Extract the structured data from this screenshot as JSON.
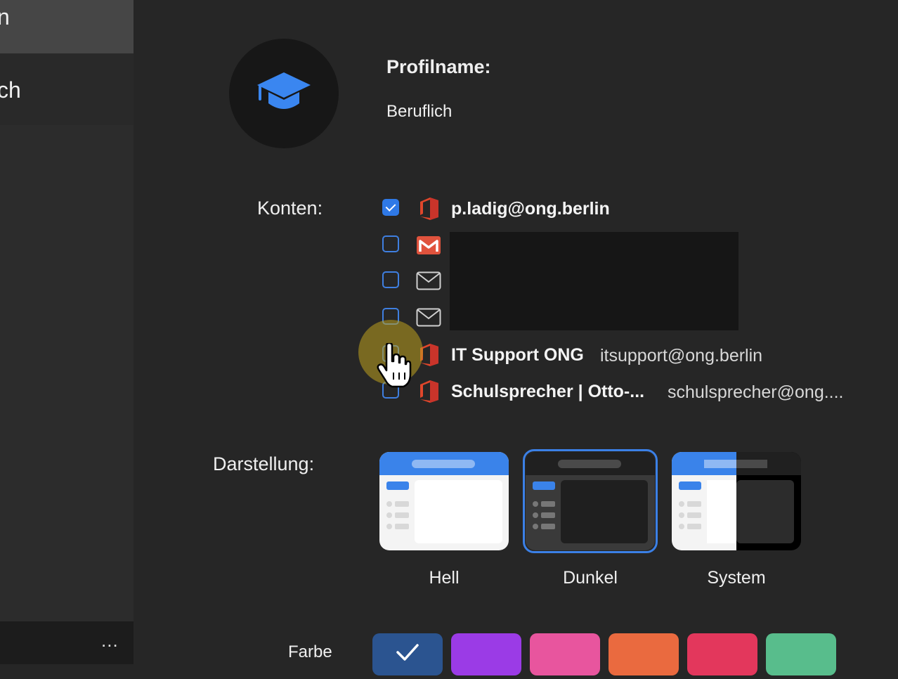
{
  "sidebar": {
    "items": [
      {
        "label": "n"
      },
      {
        "label": "ch"
      }
    ],
    "more_label": "..."
  },
  "profile": {
    "name_label": "Profilname:",
    "name_value": "Beruflich",
    "avatar_icon": "graduation-cap-icon"
  },
  "accounts": {
    "label": "Konten:",
    "items": [
      {
        "name": "p.ladig@ong.berlin",
        "email": "",
        "icon": "office-icon",
        "checked": true
      },
      {
        "name": "",
        "email": "",
        "icon": "gmail-icon",
        "checked": false
      },
      {
        "name": "",
        "email": "",
        "icon": "mail-icon",
        "checked": false
      },
      {
        "name": "",
        "email": "",
        "icon": "mail-icon",
        "checked": false
      },
      {
        "name": "IT Support ONG",
        "email": "itsupport@ong.berlin",
        "icon": "office-icon",
        "checked": false
      },
      {
        "name": "Schulsprecher | Otto-...",
        "email": "schulsprecher@ong....",
        "icon": "office-icon",
        "checked": false
      }
    ]
  },
  "appearance": {
    "label": "Darstellung:",
    "options": [
      {
        "label": "Hell",
        "selected": false
      },
      {
        "label": "Dunkel",
        "selected": true
      },
      {
        "label": "System",
        "selected": false
      }
    ]
  },
  "color": {
    "label": "Farbe",
    "swatches": [
      "#2b5490",
      "#9b3be6",
      "#e8559e",
      "#ea6a3f",
      "#e3375c",
      "#58bd8c"
    ],
    "selected_index": 0
  }
}
